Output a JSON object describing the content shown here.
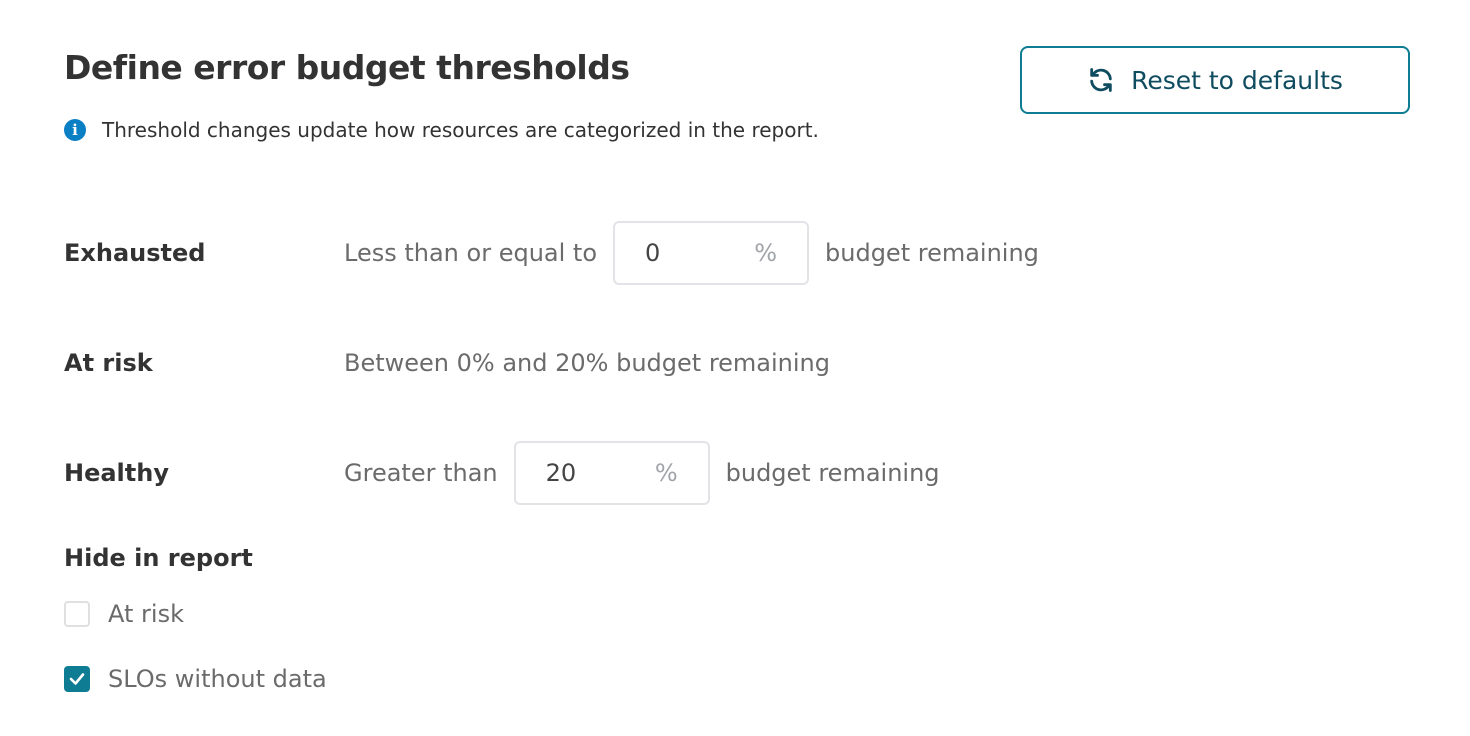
{
  "header": {
    "title": "Define error budget thresholds",
    "info_icon": "info-icon",
    "info_text": "Threshold changes update how resources are categorized in the report.",
    "reset_button": {
      "label": "Reset to defaults",
      "icon": "refresh-icon"
    }
  },
  "thresholds": [
    {
      "label": "Exhausted",
      "prefix": "Less than or equal to",
      "value": "0",
      "unit": "%",
      "suffix": "budget remaining"
    },
    {
      "label": "At risk",
      "text": "Between 0% and 20% budget remaining"
    },
    {
      "label": "Healthy",
      "prefix": "Greater than",
      "value": "20",
      "unit": "%",
      "suffix": "budget remaining"
    }
  ],
  "hide_in_report": {
    "title": "Hide in report",
    "options": [
      {
        "label": "At risk",
        "checked": false
      },
      {
        "label": "SLOs without data",
        "checked": true
      }
    ]
  },
  "colors": {
    "accent": "#0e7c93",
    "info": "#0a7fc4",
    "button_text": "#0f4c60",
    "heading": "#333333",
    "muted": "#6b6b6b"
  }
}
